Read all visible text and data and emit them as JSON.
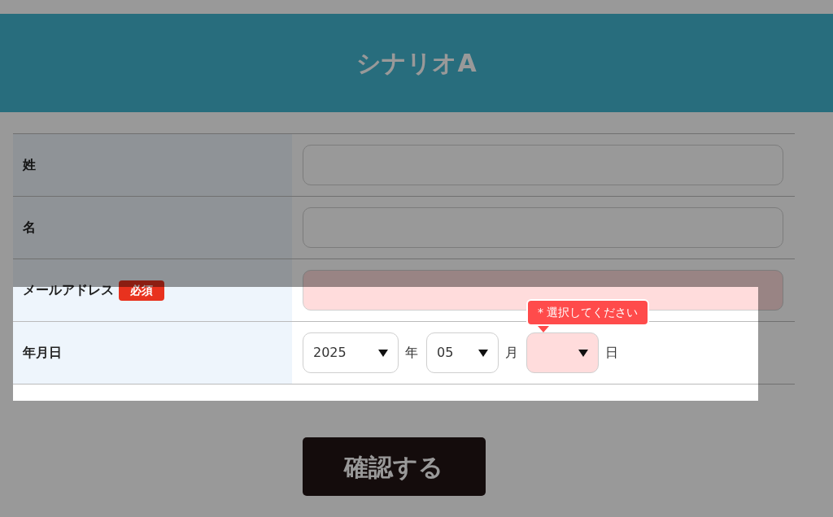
{
  "header": {
    "title": "シナリオA"
  },
  "fields": [
    {
      "kind": "text",
      "label": "姓",
      "error": false
    },
    {
      "kind": "text",
      "label": "名",
      "error": false
    },
    {
      "kind": "text",
      "label": "メールアドレス",
      "badge": "必須",
      "error": true
    },
    {
      "kind": "date",
      "label": "年月日",
      "selects": [
        {
          "value": "2025",
          "unit": "年",
          "error": false
        },
        {
          "value": "05",
          "unit": "月",
          "error": false
        },
        {
          "unit": "日",
          "error": true,
          "tooltip": "* 選択してください"
        }
      ]
    }
  ],
  "submit": "確認する"
}
